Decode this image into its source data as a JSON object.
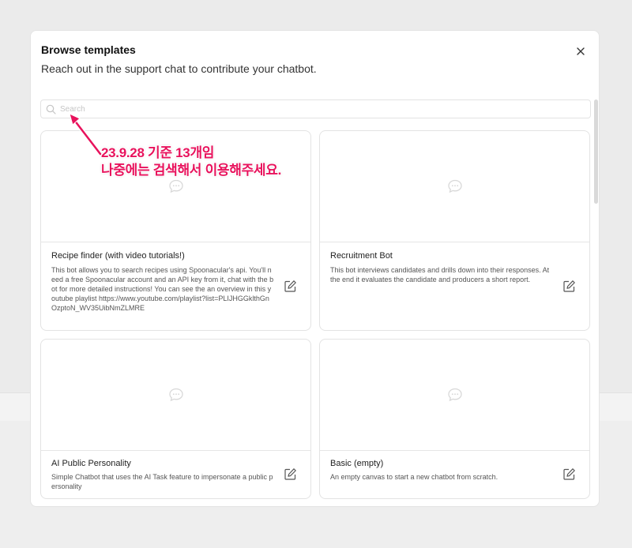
{
  "modal": {
    "title": "Browse templates",
    "subtitle": "Reach out in the support chat to contribute your chatbot."
  },
  "search": {
    "placeholder": "Search",
    "value": ""
  },
  "annotation": {
    "line1": "23.9.28 기준 13개임",
    "line2": "나중에는 검색해서 이용해주세요."
  },
  "templates": [
    {
      "title": "Recipe finder (with video tutorials!)",
      "description": "This bot allows you to search recipes using Spoonacular's api. You'll need a free Spoonacular account and an API key from it, chat with the bot for more detailed instructions! You can see the an overview in this youtube playlist https://www.youtube.com/playlist?list=PLIJHGGklthGnOzptoN_WV35UibNmZLMRE"
    },
    {
      "title": "Recruitment Bot",
      "description": "This bot interviews candidates and drills down into their responses. At the end it evaluates the candidate and producers a short report."
    },
    {
      "title": "AI Public Personality",
      "description": "Simple Chatbot that uses the AI Task feature to impersonate a public personality"
    },
    {
      "title": "Basic (empty)",
      "description": "An empty canvas to start a new chatbot from scratch."
    }
  ],
  "icons": {
    "close": "close-icon",
    "search": "search-icon",
    "preview": "chat-bubble-icon",
    "edit": "edit-icon"
  },
  "colors": {
    "annotation": "#e8125c",
    "border": "#e3e3e3"
  }
}
